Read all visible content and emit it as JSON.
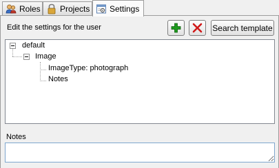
{
  "tabs": [
    {
      "label": "Roles",
      "icon": "users-icon"
    },
    {
      "label": "Projects",
      "icon": "lock-icon"
    },
    {
      "label": "Settings",
      "icon": "settings-icon",
      "active": true
    }
  ],
  "settings": {
    "description": "Edit the settings for the user",
    "add_icon": "plus-icon",
    "delete_icon": "x-icon",
    "search_template_label": "Search template",
    "tree": {
      "root": "default",
      "child": "Image",
      "leaves": [
        "ImageType: photograph",
        "Notes"
      ]
    },
    "notes": {
      "label": "Notes",
      "value": ""
    }
  },
  "colors": {
    "add": "#1e9a1e",
    "delete": "#d01818",
    "input_border": "#7ea6ce"
  }
}
